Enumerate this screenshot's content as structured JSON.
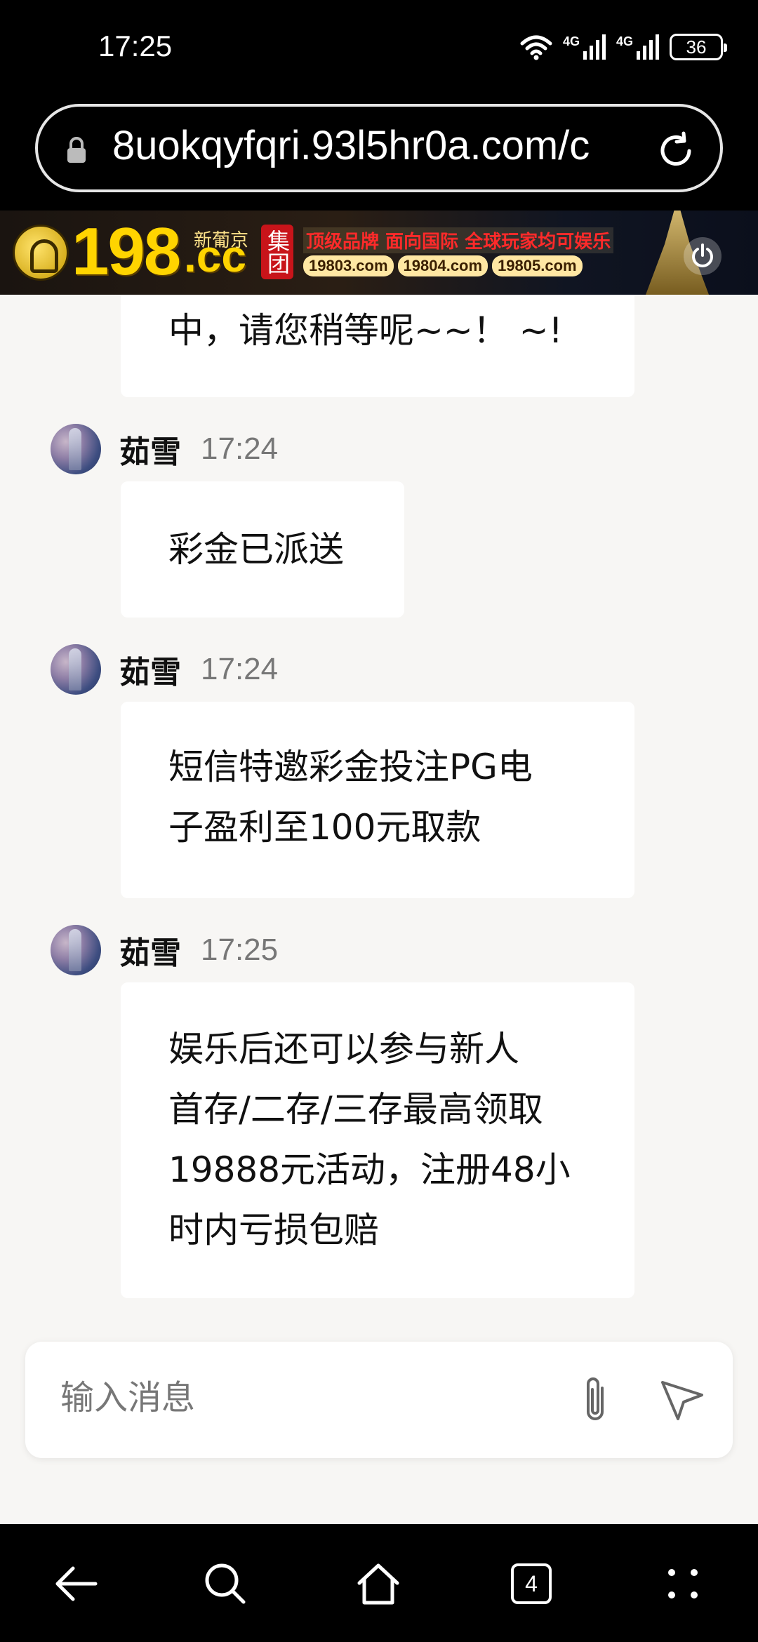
{
  "status_bar": {
    "time": "17:25",
    "network_1": "4G",
    "network_2": "4G",
    "battery": "36"
  },
  "browser": {
    "url": "8uokqyfqri.93l5hr0a.com/c",
    "tab_count": "4"
  },
  "ad_banner": {
    "brand_number": "198",
    "brand_suffix": ".cc",
    "brand_subtitle": "新葡京",
    "group_badge": "集团",
    "slogan": "顶级品牌 面向国际 全球玩家均可娱乐",
    "domains": [
      "19803.com",
      "19804.com",
      "19805.com"
    ]
  },
  "messages": [
    {
      "sender": "",
      "time": "",
      "lines": [
        "中，请您稍等呢~~！ ~!"
      ]
    },
    {
      "sender": "茹雪",
      "time": "17:24",
      "lines": [
        "彩金已派送"
      ]
    },
    {
      "sender": "茹雪",
      "time": "17:24",
      "lines": [
        "短信特邀彩金投注PG电",
        "子盈利至100元取款"
      ]
    },
    {
      "sender": "茹雪",
      "time": "17:25",
      "lines": [
        "娱乐后还可以参与新人",
        "首存/二存/三存最高领取",
        "19888元活动，注册48小",
        "时内亏损包赔"
      ]
    }
  ],
  "composer": {
    "placeholder": "输入消息",
    "value": ""
  },
  "icons": {
    "lock": "lock-icon",
    "reload": "reload-icon",
    "attach": "paperclip-icon",
    "send": "send-icon",
    "back": "back-arrow-icon",
    "search": "search-icon",
    "home": "home-icon",
    "menu": "more-dots-icon"
  }
}
